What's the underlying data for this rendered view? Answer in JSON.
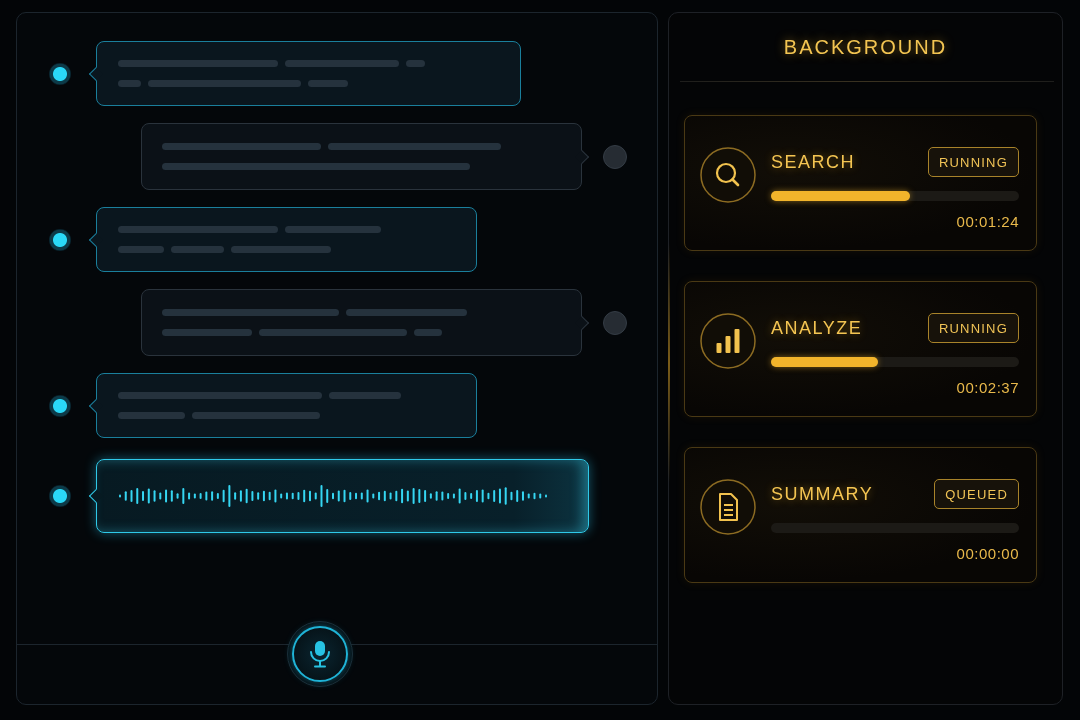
{
  "conversation": {
    "messages": [
      {
        "kind": "incoming"
      },
      {
        "kind": "outgoing"
      },
      {
        "kind": "incoming"
      },
      {
        "kind": "outgoing"
      },
      {
        "kind": "incoming"
      },
      {
        "kind": "voice"
      }
    ]
  },
  "background_panel": {
    "title": "BACKGROUND",
    "tasks": [
      {
        "kind": "search",
        "title": "SEARCH",
        "status": "RUNNING",
        "level": 0.56,
        "elapsed": "00:01:24"
      },
      {
        "kind": "analyze",
        "title": "ANALYZE",
        "status": "RUNNING",
        "level": 0.43,
        "elapsed": "00:02:37"
      },
      {
        "kind": "summary",
        "title": "SUMMARY",
        "status": "QUEUED",
        "elapsed": "00:00:00"
      }
    ]
  }
}
